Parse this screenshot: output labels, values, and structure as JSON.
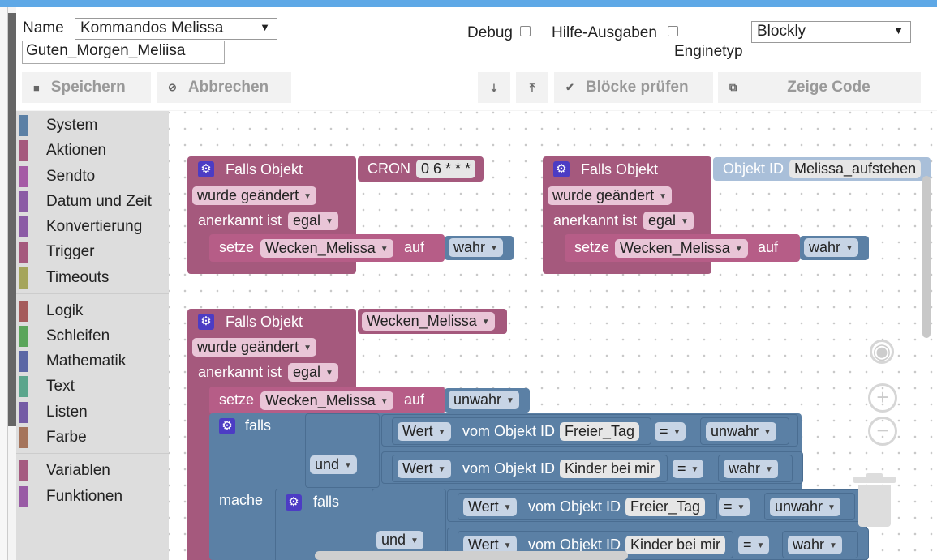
{
  "header": {
    "name_label": "Name",
    "name_value": "Kommandos Melissa",
    "text_value": "Guten_Morgen_Meliisa",
    "debug_label": "Debug",
    "hilfe_label": "Hilfe-Ausgaben",
    "engine_value": "Blockly",
    "engine_label": "Enginetyp",
    "save_label": "Speichern",
    "cancel_label": "Abbrechen",
    "check_label": "Blöcke prüfen",
    "code_label": "Zeige Code"
  },
  "toolbox": [
    {
      "label": "System",
      "color": "#5b80a5"
    },
    {
      "label": "Aktionen",
      "color": "#a5597d"
    },
    {
      "label": "Sendto",
      "color": "#a55ba5"
    },
    {
      "label": "Datum und Zeit",
      "color": "#8b5ba5"
    },
    {
      "label": "Konvertierung",
      "color": "#8b5ba5"
    },
    {
      "label": "Trigger",
      "color": "#a5597d"
    },
    {
      "label": "Timeouts",
      "color": "#a5a55b"
    },
    {
      "label": "Logik",
      "color": "#a55b5b"
    },
    {
      "label": "Schleifen",
      "color": "#5ba55b"
    },
    {
      "label": "Mathematik",
      "color": "#5b67a5"
    },
    {
      "label": "Text",
      "color": "#5ba58c"
    },
    {
      "label": "Listen",
      "color": "#745ba5"
    },
    {
      "label": "Farbe",
      "color": "#a5745b"
    },
    {
      "label": "Variablen",
      "color": "#a55b80"
    },
    {
      "label": "Funktionen",
      "color": "#995ba5"
    }
  ],
  "blocks": {
    "falls_objekt": "Falls Objekt",
    "wurde_geaendert": "wurde geändert",
    "anerkannt_ist": "anerkannt ist",
    "egal": "egal",
    "setze": "setze",
    "auf": "auf",
    "cron": "CRON",
    "cron_value": "0 6 * * *",
    "objekt_id": "Objekt ID",
    "objekt_id_value": "Melissa_aufstehen",
    "var_wecken": "Wecken_Melissa",
    "wahr": "wahr",
    "unwahr": "unwahr",
    "falls": "falls",
    "mache": "mache",
    "und": "und",
    "wert": "Wert",
    "vom_objekt_id": "vom Objekt ID",
    "freier_tag": "Freier_Tag",
    "kinder_bei_mir": "Kinder bei mir",
    "eq": "="
  }
}
